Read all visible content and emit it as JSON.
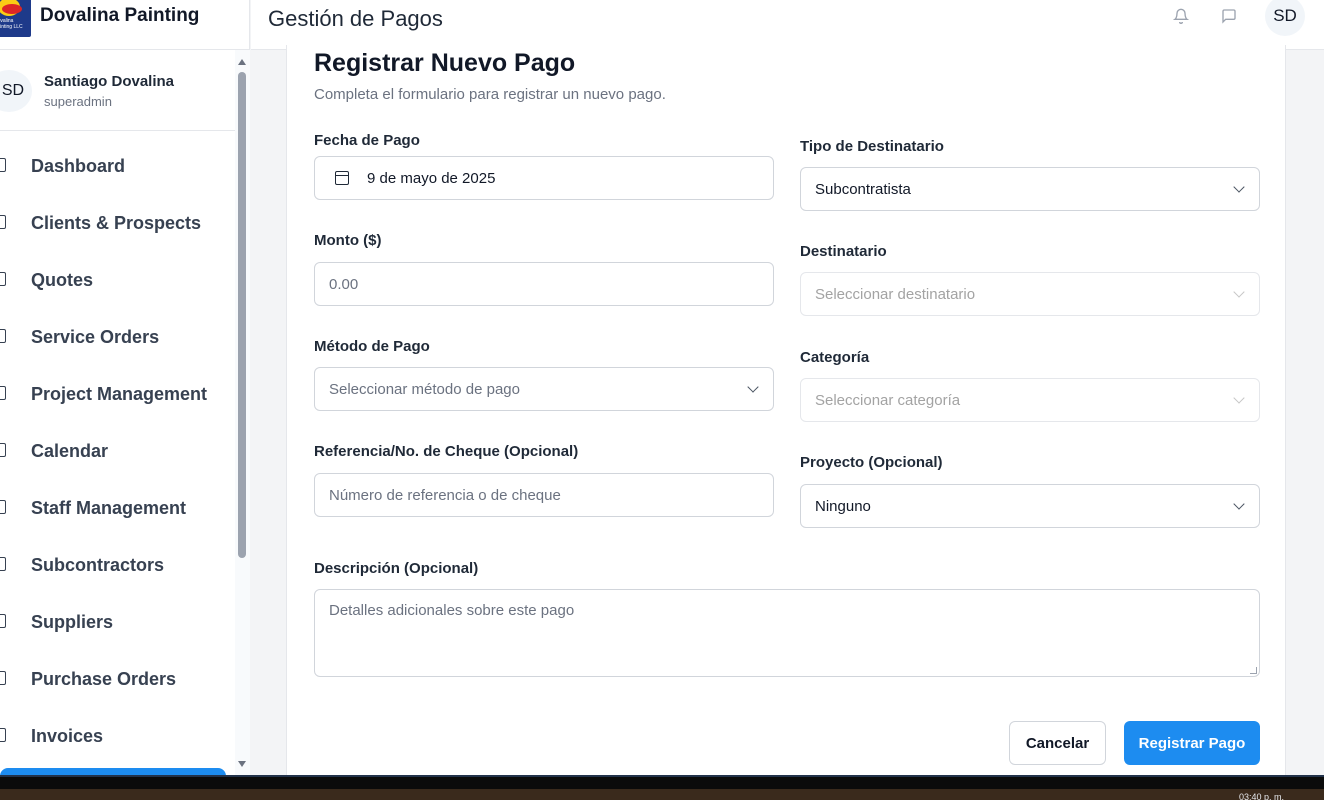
{
  "brand": {
    "name": "Dovalina Painting",
    "logo_text": "Dovalina Painting LLC"
  },
  "user": {
    "initials": "SD",
    "name": "Santiago Dovalina",
    "role": "superadmin"
  },
  "nav": [
    {
      "label": "Dashboard",
      "icon": "home-icon"
    },
    {
      "label": "Clients & Prospects",
      "icon": "users-icon"
    },
    {
      "label": "Quotes",
      "icon": "file-icon"
    },
    {
      "label": "Service Orders",
      "icon": "clipboard-icon"
    },
    {
      "label": "Project Management",
      "icon": "workflow-icon"
    },
    {
      "label": "Calendar",
      "icon": "calendar-icon"
    },
    {
      "label": "Staff Management",
      "icon": "gear-icon"
    },
    {
      "label": "Subcontractors",
      "icon": "briefcase-icon"
    },
    {
      "label": "Suppliers",
      "icon": "package-icon"
    },
    {
      "label": "Purchase Orders",
      "icon": "receipt-icon"
    },
    {
      "label": "Invoices",
      "icon": "document-icon"
    }
  ],
  "header": {
    "title": "Gestión de Pagos",
    "avatar": "SD"
  },
  "form": {
    "title": "Registrar Nuevo Pago",
    "subtitle": "Completa el formulario para registrar un nuevo pago.",
    "fecha_label": "Fecha de Pago",
    "fecha_value": "9 de mayo de 2025",
    "monto_label": "Monto ($)",
    "monto_placeholder": "0.00",
    "metodo_label": "Método de Pago",
    "metodo_placeholder": "Seleccionar método de pago",
    "referencia_label": "Referencia/No. de Cheque (Opcional)",
    "referencia_placeholder": "Número de referencia o de cheque",
    "tipo_label": "Tipo de Destinatario",
    "tipo_value": "Subcontratista",
    "destinatario_label": "Destinatario",
    "destinatario_placeholder": "Seleccionar destinatario",
    "categoria_label": "Categoría",
    "categoria_placeholder": "Seleccionar categoría",
    "proyecto_label": "Proyecto (Opcional)",
    "proyecto_value": "Ninguno",
    "descripcion_label": "Descripción (Opcional)",
    "descripcion_placeholder": "Detalles adicionales sobre este pago",
    "cancel_label": "Cancelar",
    "submit_label": "Registrar Pago"
  },
  "taskbar": {
    "clock": "03:40 p. m."
  },
  "colors": {
    "primary": "#1d8cf0"
  }
}
